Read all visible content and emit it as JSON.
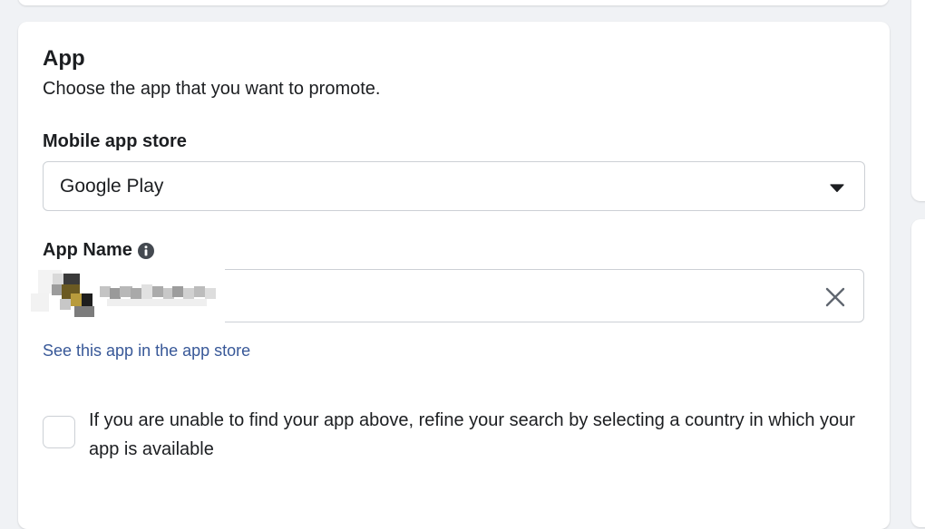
{
  "app_section": {
    "title": "App",
    "description": "Choose the app that you want to promote."
  },
  "mobile_store": {
    "label": "Mobile app store",
    "selected": "Google Play",
    "caret_icon": "caret-down-icon"
  },
  "app_name": {
    "label": "App Name",
    "info_icon": "info-icon",
    "clear_icon": "close-icon",
    "store_link": "See this app in the app store"
  },
  "country_refine": {
    "checked": false,
    "label": "If you are unable to find your app above, refine your search by selecting a country in which your app is available"
  },
  "colors": {
    "link": "#385898",
    "background": "#f0f2f5",
    "border": "#ccd0d5"
  }
}
